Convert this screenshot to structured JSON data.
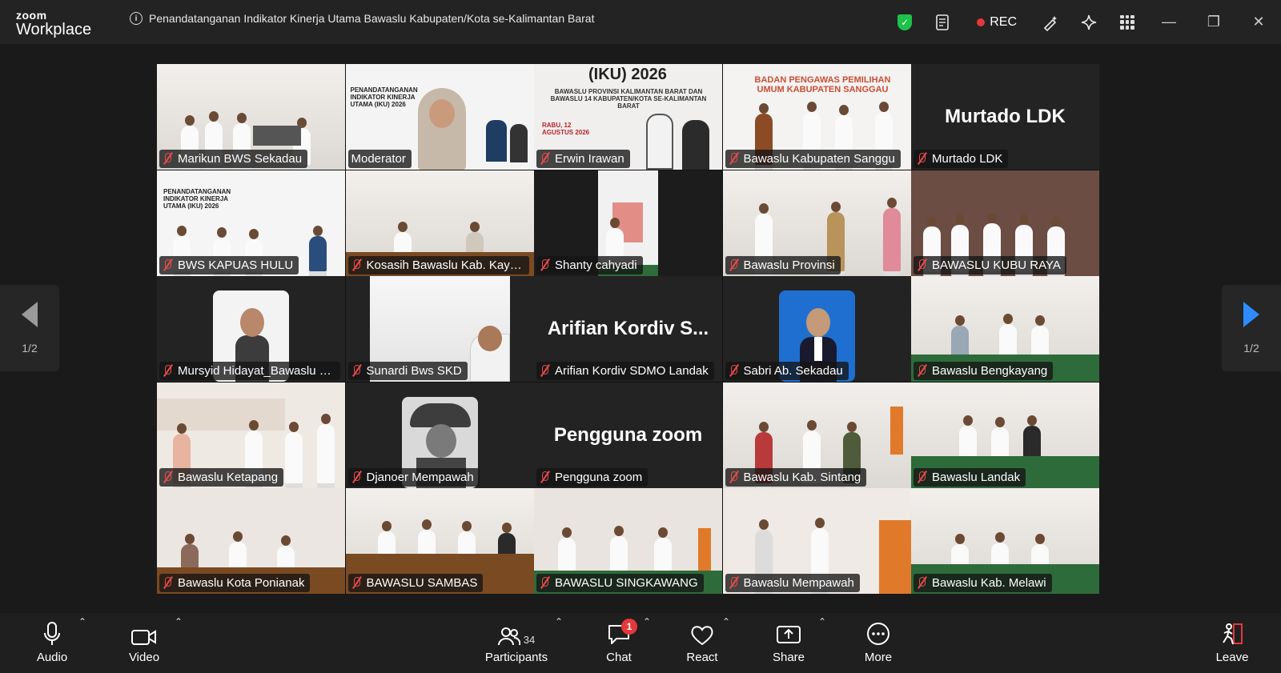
{
  "app": {
    "brand_top": "zoom",
    "brand_bottom": "Workplace",
    "meeting_title": "Penandatanganan Indikator Kinerja Utama Bawaslu Kabupaten/Kota se-Kalimantan Barat",
    "rec_label": "REC"
  },
  "pager": {
    "left_page": "1/2",
    "right_page": "1/2"
  },
  "big_names": {
    "murtado": "Murtado LDK",
    "arifian": "Arifian  Kordiv S...",
    "pengguna": "Pengguna zoom"
  },
  "tiles": [
    {
      "name": "Marikun BWS Sekadau"
    },
    {
      "name": "Moderator"
    },
    {
      "name": "Erwin Irawan"
    },
    {
      "name": "Bawaslu Kabupaten Sanggu"
    },
    {
      "name": "Murtado LDK"
    },
    {
      "name": "BWS KAPUAS HULU"
    },
    {
      "name": "Kosasih Bawaslu Kab. Kayon..."
    },
    {
      "name": "Shanty cahyadi"
    },
    {
      "name": "Bawaslu Provinsi"
    },
    {
      "name": "BAWASLU KUBU RAYA"
    },
    {
      "name": "Mursyid Hidayat_Bawaslu K..."
    },
    {
      "name": "Sunardi Bws SKD"
    },
    {
      "name": "Arifian Kordiv SDMO Landak"
    },
    {
      "name": "Sabri Ab. Sekadau"
    },
    {
      "name": "Bawaslu Bengkayang"
    },
    {
      "name": "Bawaslu Ketapang"
    },
    {
      "name": "Djanoer Mempawah"
    },
    {
      "name": "Pengguna zoom"
    },
    {
      "name": "Bawaslu Kab. Sintang"
    },
    {
      "name": "Bawaslu Landak"
    },
    {
      "name": "Bawaslu Kota Ponianak"
    },
    {
      "name": "BAWASLU SAMBAS"
    },
    {
      "name": "BAWASLU SINGKAWANG"
    },
    {
      "name": "Bawaslu Mempawah"
    },
    {
      "name": "Bawaslu Kab. Melawi"
    }
  ],
  "scene_text": {
    "iku_title": "(IKU) 2026",
    "iku_sub": "BAWASLU PROVINSI KALIMANTAN BARAT DAN BAWASLU 14 KABUPATEN/KOTA SE-KALIMANTAN BARAT",
    "iku_date": "RABU, 12 AGUSTUS 2026",
    "moderator_slide": "PENANDATANGANAN INDIKATOR KINERJA UTAMA (IKU) 2026",
    "sanggau_banner": "BADAN PENGAWAS PEMILIHAN UMUM KABUPATEN SANGGAU",
    "kapuas_slide": "PENANDATANGANAN INDIKATOR KINERJA UTAMA (IKU) 2026"
  },
  "toolbar": {
    "audio": "Audio",
    "video": "Video",
    "participants": "Participants",
    "participants_count": "34",
    "chat": "Chat",
    "chat_badge": "1",
    "react": "React",
    "share": "Share",
    "more": "More",
    "leave": "Leave"
  }
}
